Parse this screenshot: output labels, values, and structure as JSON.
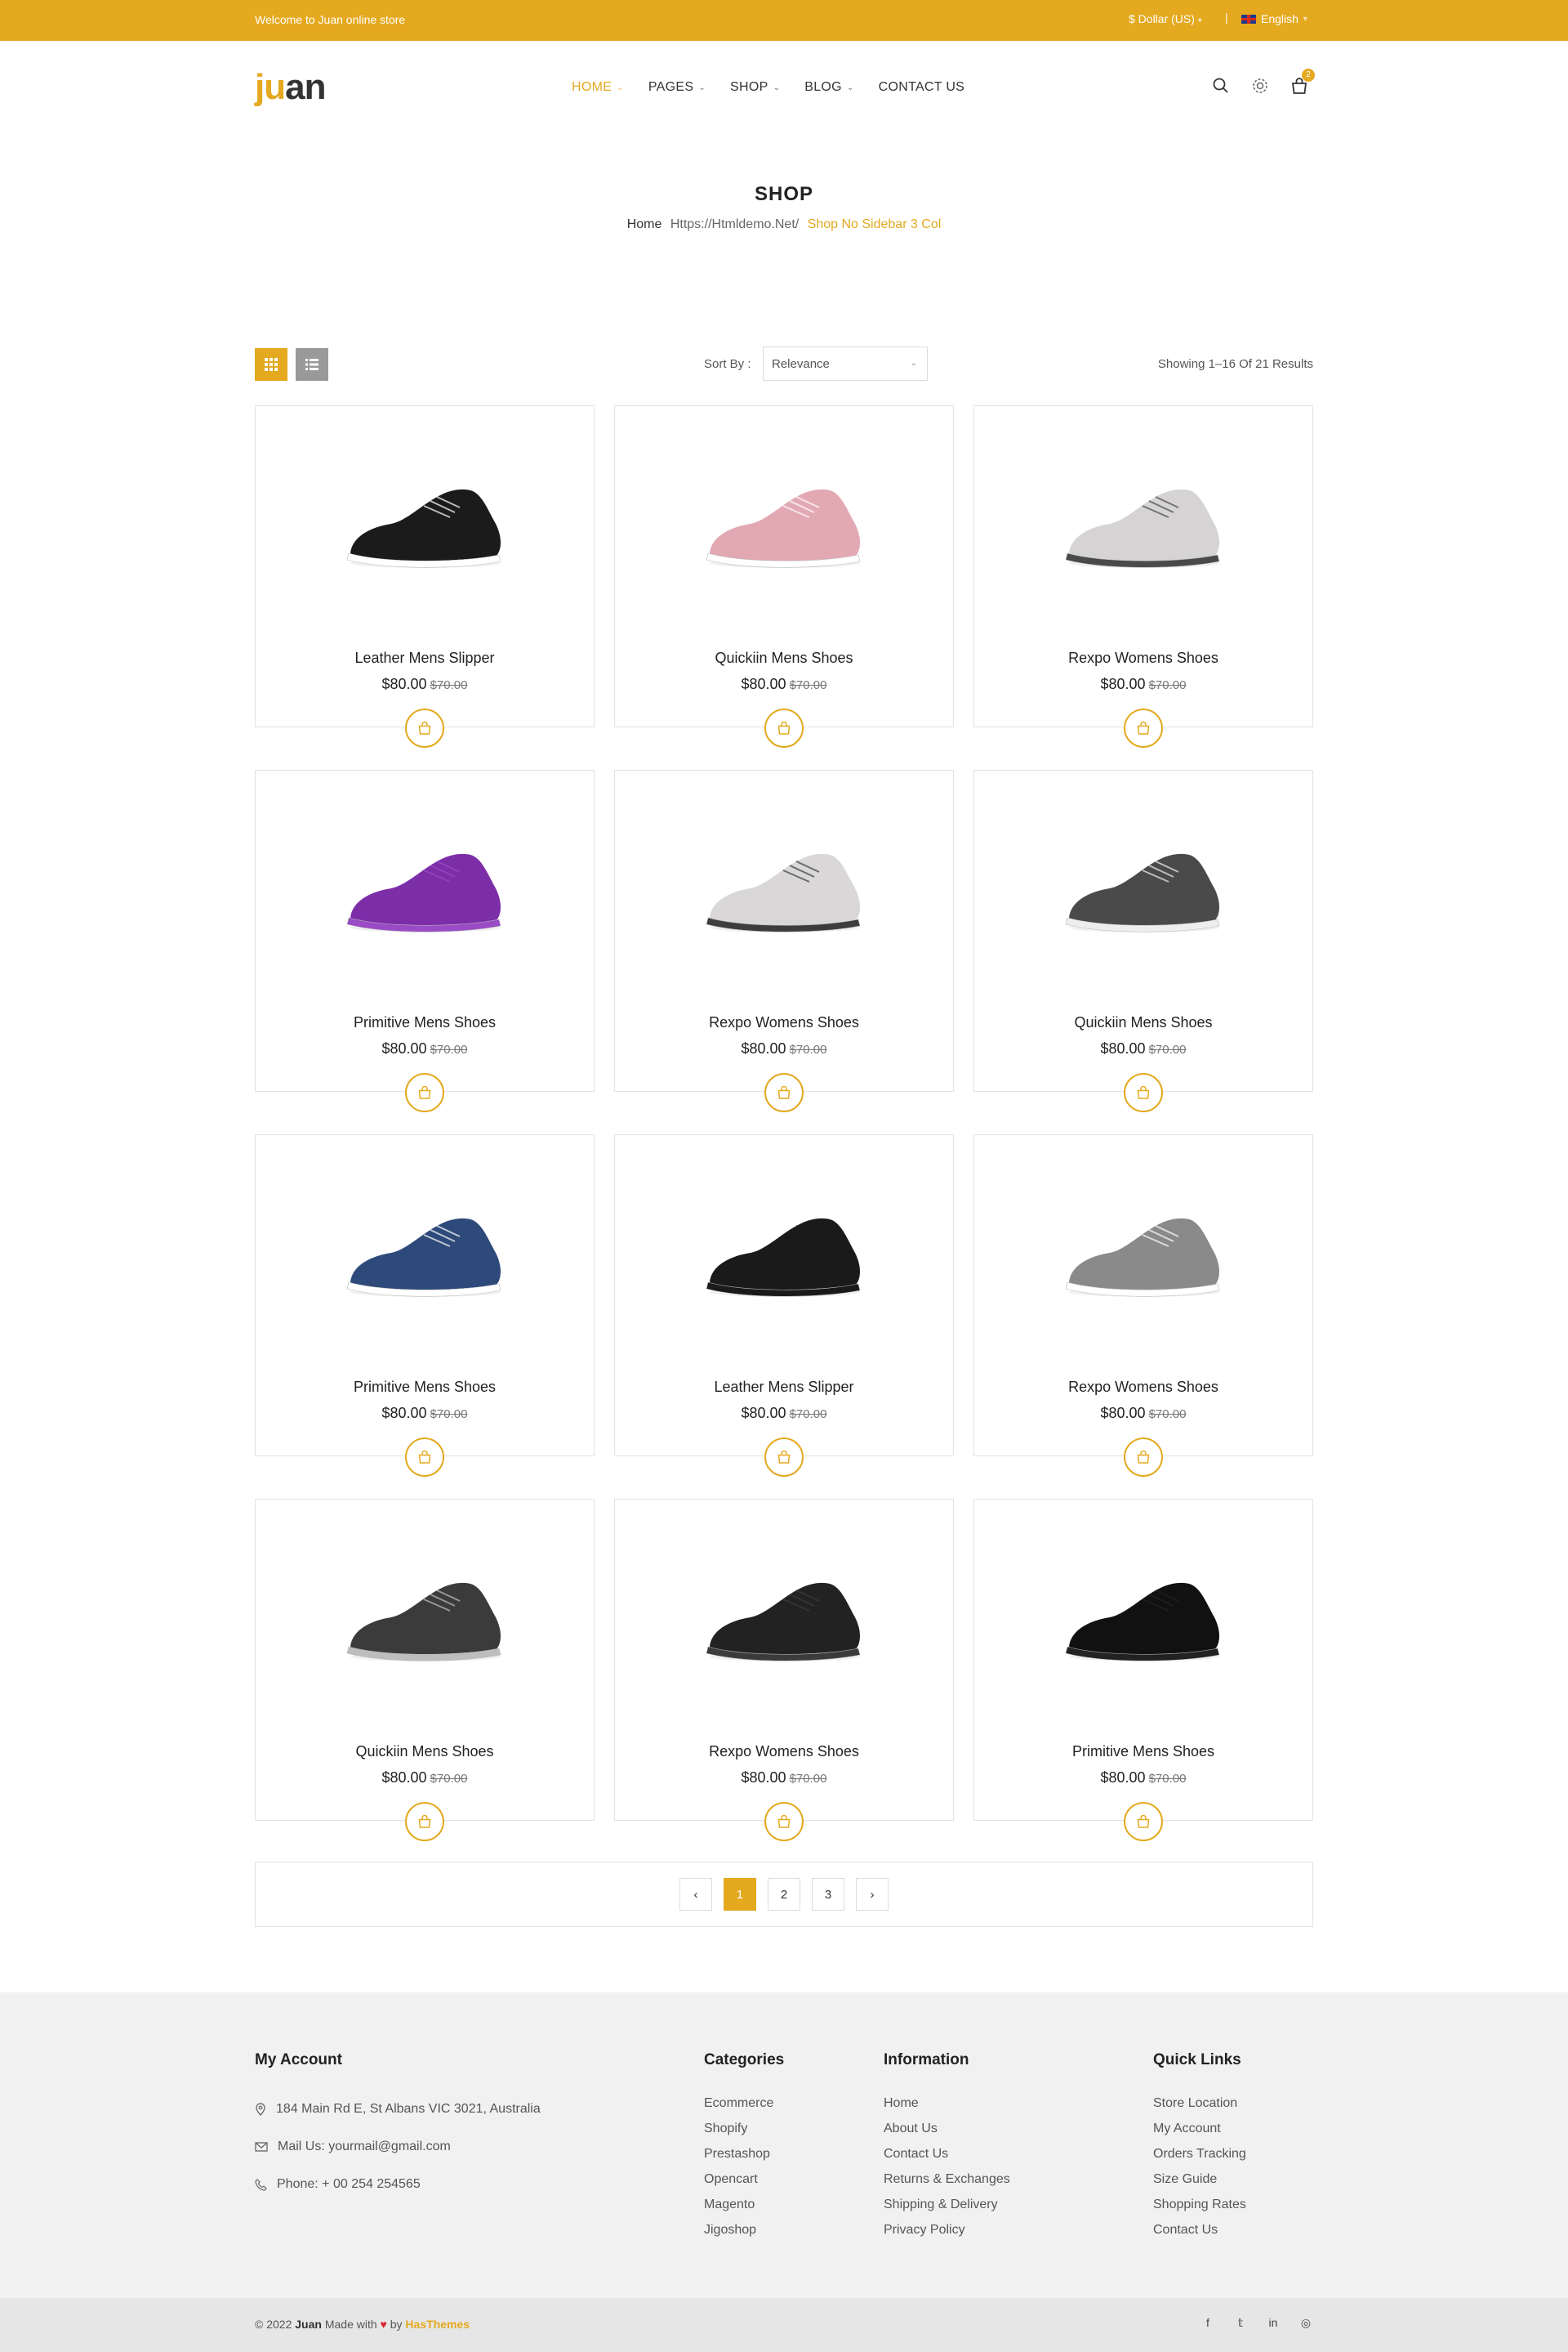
{
  "topbar": {
    "welcome": "Welcome to Juan online store",
    "currency": "$ Dollar (US)",
    "language": "English"
  },
  "header": {
    "logo_accent": "ju",
    "logo_rest": "an",
    "nav": [
      {
        "label": "HOME",
        "active": true,
        "has_dropdown": true
      },
      {
        "label": "PAGES",
        "has_dropdown": true
      },
      {
        "label": "SHOP",
        "has_dropdown": true
      },
      {
        "label": "BLOG",
        "has_dropdown": true
      },
      {
        "label": "CONTACT US",
        "has_dropdown": false
      }
    ],
    "icons": [
      "search-icon",
      "gear-icon",
      "cart-icon"
    ],
    "cart_count": "2"
  },
  "page": {
    "title": "SHOP",
    "breadcrumb": [
      "Home",
      "Https://Htmldemo.Net/",
      "Shop No Sidebar 3 Col"
    ]
  },
  "toolbar": {
    "sort_label": "Sort By :",
    "sort_value": "Relevance",
    "showing": "Showing 1–16 Of 21 Results"
  },
  "products": [
    {
      "name": "Leather Mens Slipper",
      "price": "$80.00",
      "old_price": "$70.00",
      "color": "#1b1b1b",
      "accent": "#ffffff"
    },
    {
      "name": "Quickiin Mens Shoes",
      "price": "$80.00",
      "old_price": "$70.00",
      "color": "#e2a9b3",
      "accent": "#ffffff"
    },
    {
      "name": "Rexpo Womens Shoes",
      "price": "$80.00",
      "old_price": "$70.00",
      "color": "#d6d3d4",
      "accent": "#4a4a4a"
    },
    {
      "name": "Primitive Mens Shoes",
      "price": "$80.00",
      "old_price": "$70.00",
      "color": "#7b2ea8",
      "accent": "#9a4bc6"
    },
    {
      "name": "Rexpo Womens Shoes",
      "price": "$80.00",
      "old_price": "$70.00",
      "color": "#d9d7d8",
      "accent": "#3d3d3d"
    },
    {
      "name": "Quickiin Mens Shoes",
      "price": "$80.00",
      "old_price": "$70.00",
      "color": "#4a4a4a",
      "accent": "#eeeeee"
    },
    {
      "name": "Primitive Mens Shoes",
      "price": "$80.00",
      "old_price": "$70.00",
      "color": "#2d4a7a",
      "accent": "#ffffff"
    },
    {
      "name": "Leather Mens Slipper",
      "price": "$80.00",
      "old_price": "$70.00",
      "color": "#1a1a1a",
      "accent": "#1a1a1a"
    },
    {
      "name": "Rexpo Womens Shoes",
      "price": "$80.00",
      "old_price": "$70.00",
      "color": "#8a8a8a",
      "accent": "#ffffff"
    },
    {
      "name": "Quickiin Mens Shoes",
      "price": "$80.00",
      "old_price": "$70.00",
      "color": "#3b3b3b",
      "accent": "#bdbdbd"
    },
    {
      "name": "Rexpo Womens Shoes",
      "price": "$80.00",
      "old_price": "$70.00",
      "color": "#222222",
      "accent": "#3b3b3b"
    },
    {
      "name": "Primitive Mens Shoes",
      "price": "$80.00",
      "old_price": "$70.00",
      "color": "#111111",
      "accent": "#222222"
    }
  ],
  "pagination": {
    "prev": "‹",
    "pages": [
      "1",
      "2",
      "3"
    ],
    "current": "1",
    "next": "›"
  },
  "footer": {
    "account": {
      "title": "My Account",
      "address": "184 Main Rd E, St Albans VIC 3021, Australia",
      "mail": "Mail Us: yourmail@gmail.com",
      "phone": "Phone: + 00 254 254565"
    },
    "categories": {
      "title": "Categories",
      "links": [
        "Ecommerce",
        "Shopify",
        "Prestashop",
        "Opencart",
        "Magento",
        "Jigoshop"
      ]
    },
    "information": {
      "title": "Information",
      "links": [
        "Home",
        "About Us",
        "Contact Us",
        "Returns & Exchanges",
        "Shipping & Delivery",
        "Privacy Policy"
      ]
    },
    "quick_links": {
      "title": "Quick Links",
      "links": [
        "Store Location",
        "My Account",
        "Orders Tracking",
        "Size Guide",
        "Shopping Rates",
        "Contact Us"
      ]
    },
    "copyright_prefix": "© 2022",
    "copyright_brand": "Juan",
    "copyright_made": "Made with",
    "copyright_by": "by",
    "copyright_author": "HasThemes",
    "social": [
      "f",
      "t",
      "in",
      "ig"
    ]
  },
  "colors": {
    "accent": "#e4a91f",
    "footer_bg": "#f1f1f1",
    "copy_bg": "#e6e6e6"
  }
}
